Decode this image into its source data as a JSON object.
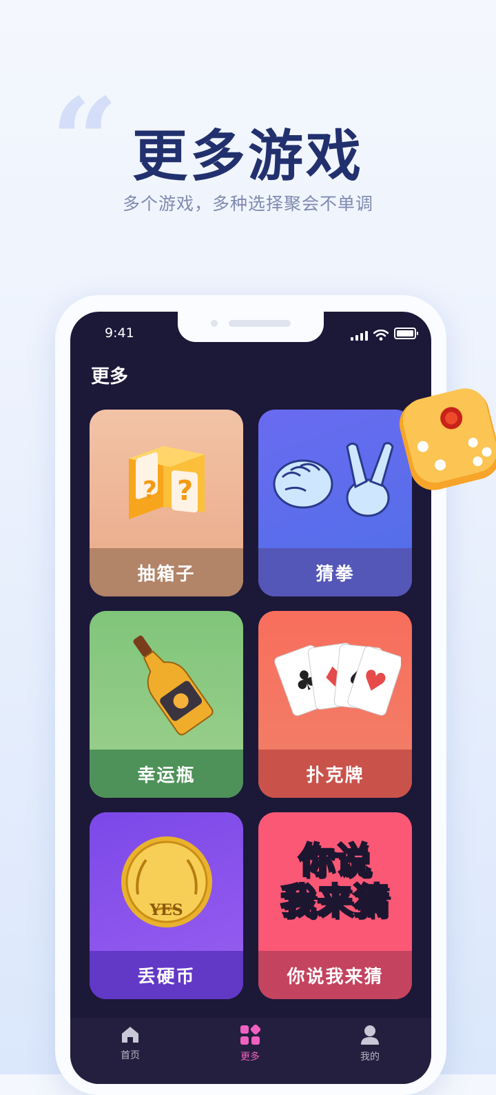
{
  "hero": {
    "quote": "“",
    "title": "更多游戏",
    "subtitle": "多个游戏，多种选择聚会不单调"
  },
  "status_bar": {
    "time": "9:41"
  },
  "page": {
    "title": "更多"
  },
  "games": [
    {
      "label": "抽箱子",
      "icon": "mystery-box-icon"
    },
    {
      "label": "猜拳",
      "icon": "rock-paper-scissors-icon"
    },
    {
      "label": "幸运瓶",
      "icon": "bottle-icon"
    },
    {
      "label": "扑克牌",
      "icon": "playing-cards-icon"
    },
    {
      "label": "丢硬币",
      "icon": "coin-icon",
      "coin_text": "YES"
    },
    {
      "label": "你说我来猜",
      "icon": "guess-word-icon",
      "art_lines": [
        "你说",
        "我来猜"
      ]
    }
  ],
  "tab_bar": {
    "items": [
      {
        "label": "首页",
        "icon": "home-icon",
        "active": false
      },
      {
        "label": "更多",
        "icon": "grid-icon",
        "active": true
      },
      {
        "label": "我的",
        "icon": "user-icon",
        "active": false
      }
    ],
    "active_color": "#f261c2"
  },
  "colors": {
    "accent": "#f261c2",
    "title": "#22306e",
    "screen_bg": "#1c1838"
  }
}
